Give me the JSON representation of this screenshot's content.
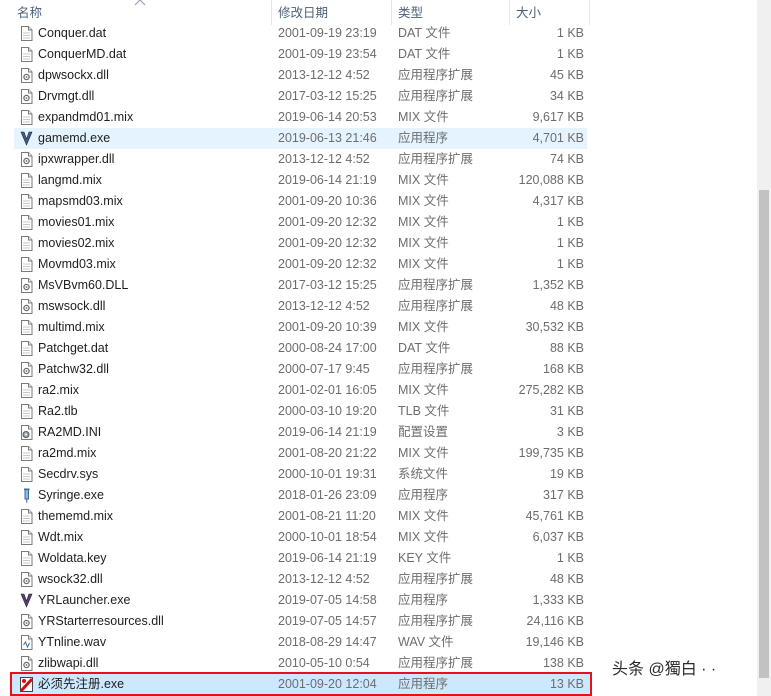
{
  "columns": {
    "name": "名称",
    "date": "修改日期",
    "type": "类型",
    "size": "大小"
  },
  "files": [
    {
      "name": "Conquer.dat",
      "date": "2001-09-19 23:19",
      "type": "DAT 文件",
      "size": "1 KB",
      "icon": "dat-file-icon"
    },
    {
      "name": "ConquerMD.dat",
      "date": "2001-09-19 23:54",
      "type": "DAT 文件",
      "size": "1 KB",
      "icon": "dat-file-icon"
    },
    {
      "name": "dpwsockx.dll",
      "date": "2013-12-12 4:52",
      "type": "应用程序扩展",
      "size": "45 KB",
      "icon": "dll-file-icon"
    },
    {
      "name": "Drvmgt.dll",
      "date": "2017-03-12 15:25",
      "type": "应用程序扩展",
      "size": "34 KB",
      "icon": "dll-file-icon"
    },
    {
      "name": "expandmd01.mix",
      "date": "2019-06-14 20:53",
      "type": "MIX 文件",
      "size": "9,617 KB",
      "icon": "mix-file-icon"
    },
    {
      "name": "gamemd.exe",
      "date": "2019-06-13 21:46",
      "type": "应用程序",
      "size": "4,701 KB",
      "icon": "gamemd-app-icon"
    },
    {
      "name": "ipxwrapper.dll",
      "date": "2013-12-12 4:52",
      "type": "应用程序扩展",
      "size": "74 KB",
      "icon": "dll-file-icon"
    },
    {
      "name": "langmd.mix",
      "date": "2019-06-14 21:19",
      "type": "MIX 文件",
      "size": "120,088 KB",
      "icon": "mix-file-icon"
    },
    {
      "name": "mapsmd03.mix",
      "date": "2001-09-20 10:36",
      "type": "MIX 文件",
      "size": "4,317 KB",
      "icon": "mix-file-icon"
    },
    {
      "name": "movies01.mix",
      "date": "2001-09-20 12:32",
      "type": "MIX 文件",
      "size": "1 KB",
      "icon": "mix-file-icon"
    },
    {
      "name": "movies02.mix",
      "date": "2001-09-20 12:32",
      "type": "MIX 文件",
      "size": "1 KB",
      "icon": "mix-file-icon"
    },
    {
      "name": "Movmd03.mix",
      "date": "2001-09-20 12:32",
      "type": "MIX 文件",
      "size": "1 KB",
      "icon": "mix-file-icon"
    },
    {
      "name": "MsVBvm60.DLL",
      "date": "2017-03-12 15:25",
      "type": "应用程序扩展",
      "size": "1,352 KB",
      "icon": "dll-file-icon"
    },
    {
      "name": "mswsock.dll",
      "date": "2013-12-12 4:52",
      "type": "应用程序扩展",
      "size": "48 KB",
      "icon": "dll-file-icon"
    },
    {
      "name": "multimd.mix",
      "date": "2001-09-20 10:39",
      "type": "MIX 文件",
      "size": "30,532 KB",
      "icon": "mix-file-icon"
    },
    {
      "name": "Patchget.dat",
      "date": "2000-08-24 17:00",
      "type": "DAT 文件",
      "size": "88 KB",
      "icon": "dat-file-icon"
    },
    {
      "name": "Patchw32.dll",
      "date": "2000-07-17 9:45",
      "type": "应用程序扩展",
      "size": "168 KB",
      "icon": "dll-file-icon"
    },
    {
      "name": "ra2.mix",
      "date": "2001-02-01 16:05",
      "type": "MIX 文件",
      "size": "275,282 KB",
      "icon": "mix-file-icon"
    },
    {
      "name": "Ra2.tlb",
      "date": "2000-03-10 19:20",
      "type": "TLB 文件",
      "size": "31 KB",
      "icon": "tlb-file-icon"
    },
    {
      "name": "RA2MD.INI",
      "date": "2019-06-14 21:19",
      "type": "配置设置",
      "size": "3 KB",
      "icon": "ini-settings-icon"
    },
    {
      "name": "ra2md.mix",
      "date": "2001-08-20 21:22",
      "type": "MIX 文件",
      "size": "199,735 KB",
      "icon": "mix-file-icon"
    },
    {
      "name": "Secdrv.sys",
      "date": "2000-10-01 19:31",
      "type": "系统文件",
      "size": "19 KB",
      "icon": "sys-file-icon"
    },
    {
      "name": "Syringe.exe",
      "date": "2018-01-26 23:09",
      "type": "应用程序",
      "size": "317 KB",
      "icon": "syringe-app-icon"
    },
    {
      "name": "thememd.mix",
      "date": "2001-08-21 11:20",
      "type": "MIX 文件",
      "size": "45,761 KB",
      "icon": "mix-file-icon"
    },
    {
      "name": "Wdt.mix",
      "date": "2000-10-01 18:54",
      "type": "MIX 文件",
      "size": "6,037 KB",
      "icon": "mix-file-icon"
    },
    {
      "name": "Woldata.key",
      "date": "2019-06-14 21:19",
      "type": "KEY 文件",
      "size": "1 KB",
      "icon": "key-file-icon"
    },
    {
      "name": "wsock32.dll",
      "date": "2013-12-12 4:52",
      "type": "应用程序扩展",
      "size": "48 KB",
      "icon": "dll-file-icon"
    },
    {
      "name": "YRLauncher.exe",
      "date": "2019-07-05 14:58",
      "type": "应用程序",
      "size": "1,333 KB",
      "icon": "yrlauncher-app-icon"
    },
    {
      "name": "YRStarterresources.dll",
      "date": "2019-07-05 14:57",
      "type": "应用程序扩展",
      "size": "24,116 KB",
      "icon": "dll-file-icon"
    },
    {
      "name": "YTnline.wav",
      "date": "2018-08-29 14:47",
      "type": "WAV 文件",
      "size": "19,146 KB",
      "icon": "wav-file-icon"
    },
    {
      "name": "zlibwapi.dll",
      "date": "2010-05-10 0:54",
      "type": "应用程序扩展",
      "size": "138 KB",
      "icon": "dll-file-icon"
    },
    {
      "name": "必须先注册.exe",
      "date": "2001-09-20 12:04",
      "type": "应用程序",
      "size": "13 KB",
      "icon": "register-app-icon"
    }
  ],
  "highlighted_row": 5,
  "selected_row": 31,
  "watermark": "头条 @獨白 · ·",
  "colors": {
    "hover": "#e5f3ff",
    "selected": "#cce8ff",
    "red_box": "#e8101a",
    "header_text": "#4c607a"
  }
}
